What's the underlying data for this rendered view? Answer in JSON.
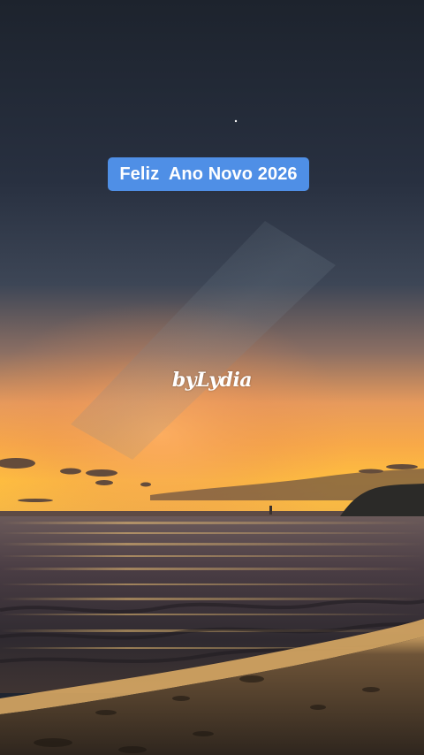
{
  "caption": {
    "text": "Feliz  Ano Novo 2026",
    "background": "#4f8fe6"
  },
  "signature": {
    "text": "byLydia"
  },
  "scene": {
    "description_colors": {
      "sky_top": "#1f2530",
      "horizon_glow": "#ffb347",
      "sea": "#3a3238",
      "sand": "#3a2f26"
    }
  }
}
